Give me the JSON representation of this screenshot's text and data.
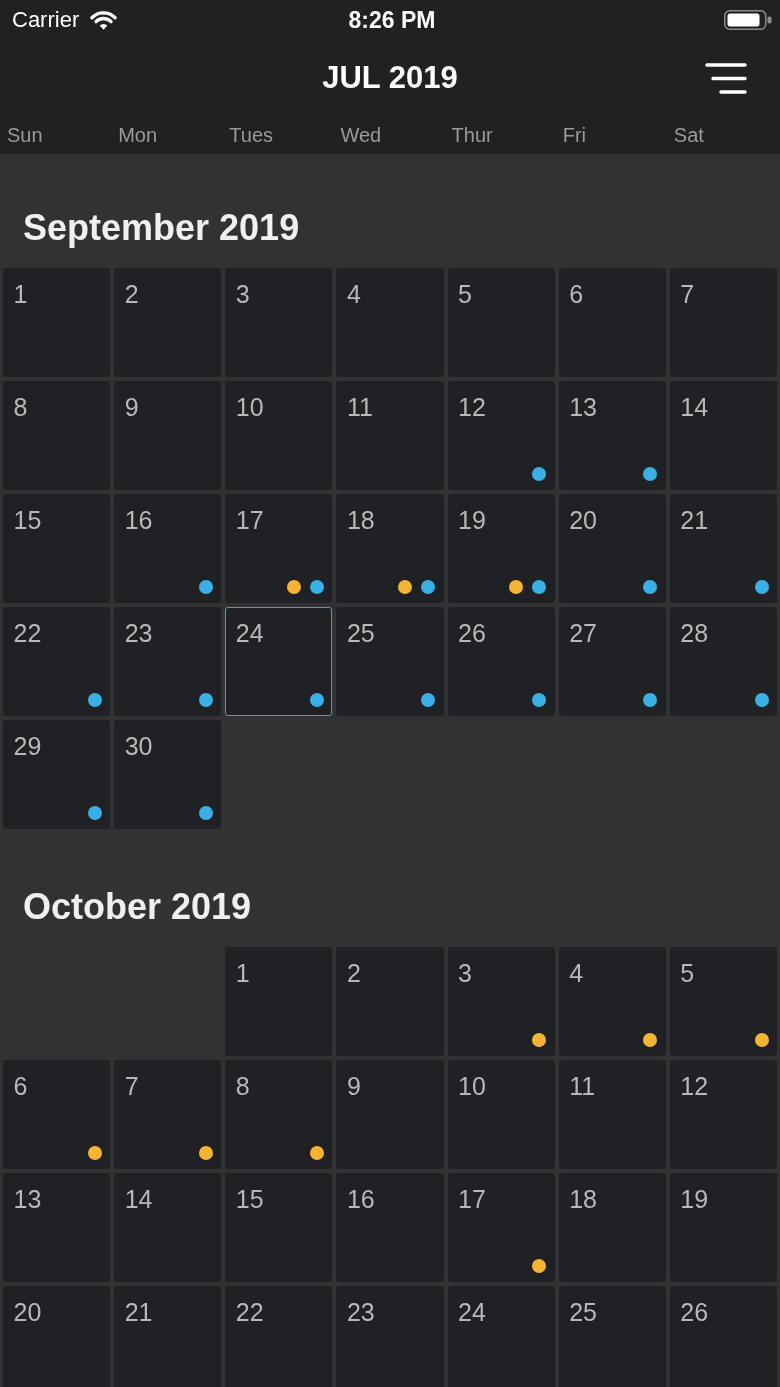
{
  "status_bar": {
    "carrier": "Carrier",
    "time": "8:26 PM"
  },
  "header": {
    "title": "JUL 2019"
  },
  "weekdays": [
    "Sun",
    "Mon",
    "Tues",
    "Wed",
    "Thur",
    "Fri",
    "Sat"
  ],
  "months": [
    {
      "title": "September 2019",
      "weeks": [
        {
          "kind": "full",
          "days": [
            {
              "label": "1",
              "selected": false
            },
            {
              "label": "2",
              "selected": false
            },
            {
              "label": "3",
              "selected": false
            },
            {
              "label": "4",
              "selected": false
            },
            {
              "label": "5",
              "selected": false
            },
            {
              "label": "6",
              "selected": false
            },
            {
              "label": "7",
              "selected": false
            }
          ]
        },
        {
          "kind": "full",
          "days": [
            {
              "label": "8",
              "selected": false
            },
            {
              "label": "9",
              "selected": false
            },
            {
              "label": "10",
              "selected": false
            },
            {
              "label": "11",
              "selected": false
            },
            {
              "label": "12",
              "selected": false,
              "dots": [
                {
                  "color": "#3aafe6"
                }
              ]
            },
            {
              "label": "13",
              "selected": false,
              "dots": [
                {
                  "color": "#3aafe6"
                }
              ]
            },
            {
              "label": "14",
              "selected": false
            }
          ]
        },
        {
          "kind": "full",
          "days": [
            {
              "label": "15",
              "selected": false
            },
            {
              "label": "16",
              "selected": false,
              "dots": [
                {
                  "color": "#3aafe6"
                }
              ]
            },
            {
              "label": "17",
              "selected": false,
              "dots": [
                {
                  "color": "#f6b434"
                },
                {
                  "color": "#3aafe6"
                }
              ]
            },
            {
              "label": "18",
              "selected": false,
              "dots": [
                {
                  "color": "#f6b434"
                },
                {
                  "color": "#3aafe6"
                }
              ]
            },
            {
              "label": "19",
              "selected": false,
              "dots": [
                {
                  "color": "#f6b434"
                },
                {
                  "color": "#3aafe6"
                }
              ]
            },
            {
              "label": "20",
              "selected": false,
              "dots": [
                {
                  "color": "#3aafe6"
                }
              ]
            },
            {
              "label": "21",
              "selected": false,
              "dots": [
                {
                  "color": "#3aafe6"
                }
              ]
            }
          ]
        },
        {
          "kind": "full",
          "days": [
            {
              "label": "22",
              "selected": false,
              "dots": [
                {
                  "color": "#3aafe6"
                }
              ]
            },
            {
              "label": "23",
              "selected": false,
              "dots": [
                {
                  "color": "#3aafe6"
                }
              ]
            },
            {
              "label": "24",
              "selected": true,
              "dots": [
                {
                  "color": "#3aafe6"
                }
              ]
            },
            {
              "label": "25",
              "selected": false,
              "dots": [
                {
                  "color": "#3aafe6"
                }
              ]
            },
            {
              "label": "26",
              "selected": false,
              "dots": [
                {
                  "color": "#3aafe6"
                }
              ]
            },
            {
              "label": "27",
              "selected": false,
              "dots": [
                {
                  "color": "#3aafe6"
                }
              ]
            },
            {
              "label": "28",
              "selected": false,
              "dots": [
                {
                  "color": "#3aafe6"
                }
              ]
            }
          ]
        },
        {
          "kind": "last",
          "days": [
            {
              "label": "29",
              "selected": false,
              "dots": [
                {
                  "color": "#3aafe6"
                }
              ]
            },
            {
              "label": "30",
              "selected": false,
              "dots": [
                {
                  "color": "#3aafe6"
                }
              ]
            }
          ]
        }
      ]
    },
    {
      "title": "October 2019",
      "weeks": [
        {
          "kind": "first",
          "days": [
            {
              "label": "1",
              "selected": false
            },
            {
              "label": "2",
              "selected": false
            },
            {
              "label": "3",
              "selected": false,
              "dots": [
                {
                  "color": "#f6b434"
                }
              ]
            },
            {
              "label": "4",
              "selected": false,
              "dots": [
                {
                  "color": "#f6b434"
                }
              ]
            },
            {
              "label": "5",
              "selected": false,
              "dots": [
                {
                  "color": "#f6b434"
                }
              ]
            }
          ]
        },
        {
          "kind": "full",
          "days": [
            {
              "label": "6",
              "selected": false,
              "dots": [
                {
                  "color": "#f6b434"
                }
              ]
            },
            {
              "label": "7",
              "selected": false,
              "dots": [
                {
                  "color": "#f6b434"
                }
              ]
            },
            {
              "label": "8",
              "selected": false,
              "dots": [
                {
                  "color": "#f6b434"
                }
              ]
            },
            {
              "label": "9",
              "selected": false
            },
            {
              "label": "10",
              "selected": false
            },
            {
              "label": "11",
              "selected": false
            },
            {
              "label": "12",
              "selected": false
            }
          ]
        },
        {
          "kind": "full",
          "days": [
            {
              "label": "13",
              "selected": false
            },
            {
              "label": "14",
              "selected": false
            },
            {
              "label": "15",
              "selected": false
            },
            {
              "label": "16",
              "selected": false
            },
            {
              "label": "17",
              "selected": false,
              "dots": [
                {
                  "color": "#f6b434"
                }
              ]
            },
            {
              "label": "18",
              "selected": false
            },
            {
              "label": "19",
              "selected": false
            }
          ]
        },
        {
          "kind": "full",
          "days": [
            {
              "label": "20",
              "selected": false
            },
            {
              "label": "21",
              "selected": false
            },
            {
              "label": "22",
              "selected": false
            },
            {
              "label": "23",
              "selected": false
            },
            {
              "label": "24",
              "selected": false
            },
            {
              "label": "25",
              "selected": false
            },
            {
              "label": "26",
              "selected": false
            }
          ]
        }
      ]
    }
  ]
}
